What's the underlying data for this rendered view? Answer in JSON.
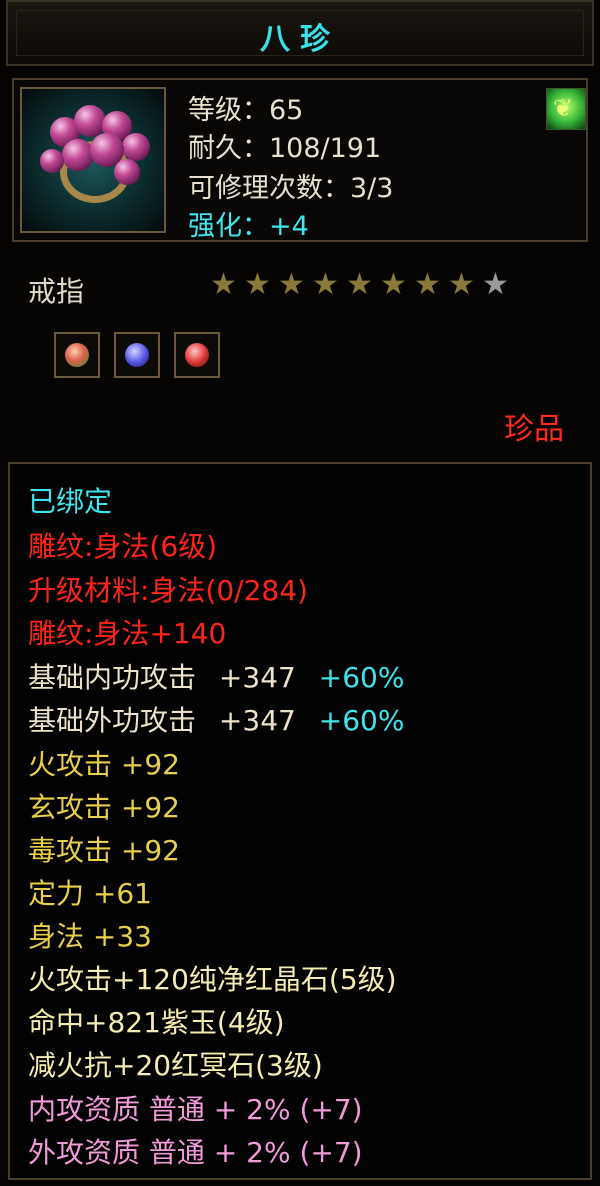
{
  "window": {
    "title": "八珍"
  },
  "header": {
    "level_label": "等级：65",
    "durability_label": "耐久：108/191",
    "repair_label": "可修理次数：3/3",
    "enhance_label": "强化：+4",
    "item_icon": "ring-icon",
    "badge_icon": "green-jade-badge-icon"
  },
  "item": {
    "type_name": "戒指",
    "stars_filled": 8,
    "stars_total": 9,
    "rarity": "珍品",
    "sockets": [
      {
        "icon": "green-gem-icon",
        "color": "#d85a5a"
      },
      {
        "icon": "blue-gem-icon",
        "color": "#5a5ae6"
      },
      {
        "icon": "red-gem-icon",
        "color": "#e23a3a"
      }
    ]
  },
  "attributes": {
    "bound": "已绑定",
    "engrave": "雕纹:身法(6级)",
    "upgrade_material": "升级材料:身法(0/284)",
    "engrave_bonus": "雕纹:身法+140",
    "inner_attack_label": "基础内功攻击",
    "inner_attack_value": "+347",
    "inner_attack_pct": "+60%",
    "outer_attack_label": "基础外功攻击",
    "outer_attack_value": "+347",
    "outer_attack_pct": "+60%",
    "fire_attack": "火攻击  +92",
    "mystic_attack": "玄攻击  +92",
    "poison_attack": "毒攻击  +92",
    "composure": "定力  +61",
    "agility": "身法  +33",
    "gem_fire": "火攻击+120纯净红晶石(5级)",
    "gem_hit": "命中+821紫玉(4级)",
    "gem_fireres": "减火抗+20红冥石(3级)",
    "inner_quality": "内攻资质  普通  + 2% (+7)",
    "outer_quality": "外攻资质  普通  + 2% (+7)"
  },
  "colors": {
    "title": "#38e0ec",
    "cyan": "#40e4ee",
    "red": "#ff2418",
    "yellow": "#e8cf4a",
    "pink": "#f29ad8"
  }
}
